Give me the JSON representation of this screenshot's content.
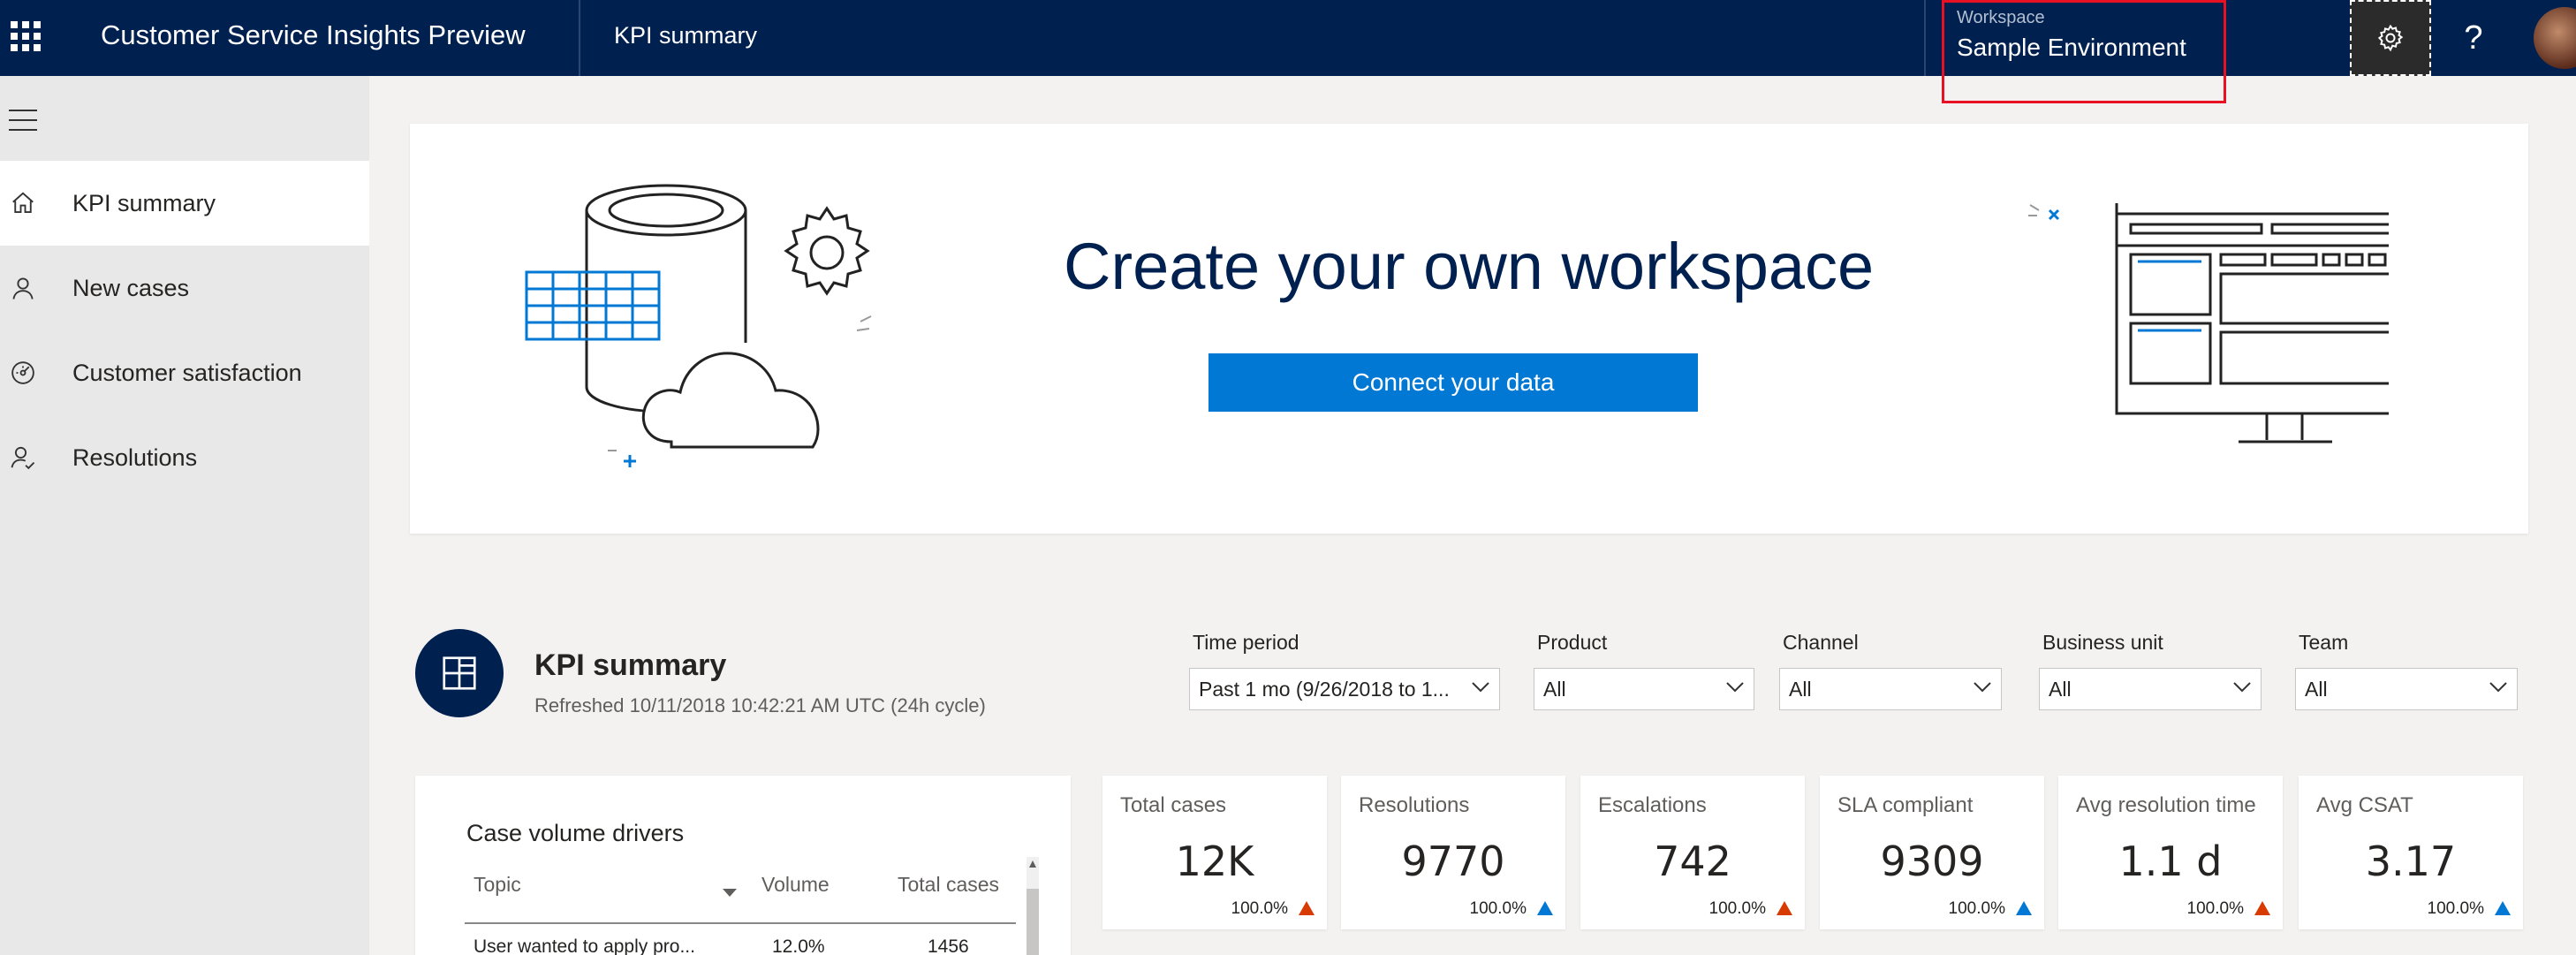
{
  "app": {
    "title": "Customer Service Insights Preview",
    "breadcrumb": "KPI summary"
  },
  "workspace": {
    "label": "Workspace",
    "value": "Sample Environment"
  },
  "header": {
    "help": "?"
  },
  "sidebar": {
    "items": [
      {
        "label": "KPI summary",
        "icon": "home-icon",
        "active": true
      },
      {
        "label": "New cases",
        "icon": "person-icon",
        "active": false
      },
      {
        "label": "Customer satisfaction",
        "icon": "gauge-icon",
        "active": false
      },
      {
        "label": "Resolutions",
        "icon": "person-check-icon",
        "active": false
      }
    ]
  },
  "hero": {
    "title": "Create your own workspace",
    "button": "Connect your data"
  },
  "kpi": {
    "title": "KPI summary",
    "refreshed": "Refreshed 10/11/2018 10:42:21 AM UTC (24h cycle)",
    "filters": [
      {
        "label": "Time period",
        "value": "Past 1 mo (9/26/2018 to 1..."
      },
      {
        "label": "Product",
        "value": "All"
      },
      {
        "label": "Channel",
        "value": "All"
      },
      {
        "label": "Business unit",
        "value": "All"
      },
      {
        "label": "Team",
        "value": "All"
      }
    ]
  },
  "case_volume": {
    "title": "Case volume drivers",
    "columns": [
      "Topic",
      "Volume",
      "Total cases"
    ],
    "rows": [
      {
        "topic": "User wanted to apply pro...",
        "volume": "12.0%",
        "total": "1456"
      }
    ]
  },
  "tiles": [
    {
      "label": "Total cases",
      "value": "12K",
      "pct": "100.0%",
      "trend_color": "#d83b01"
    },
    {
      "label": "Resolutions",
      "value": "9770",
      "pct": "100.0%",
      "trend_color": "#0078d4"
    },
    {
      "label": "Escalations",
      "value": "742",
      "pct": "100.0%",
      "trend_color": "#d83b01"
    },
    {
      "label": "SLA compliant",
      "value": "9309",
      "pct": "100.0%",
      "trend_color": "#0078d4"
    },
    {
      "label": "Avg resolution time",
      "value": "1.1 d",
      "pct": "100.0%",
      "trend_color": "#d83b01"
    },
    {
      "label": "Avg CSAT",
      "value": "3.17",
      "pct": "100.0%",
      "trend_color": "#0078d4"
    }
  ],
  "colors": {
    "topbar": "#002050",
    "accent": "#0078d4",
    "highlight": "#e81123"
  }
}
